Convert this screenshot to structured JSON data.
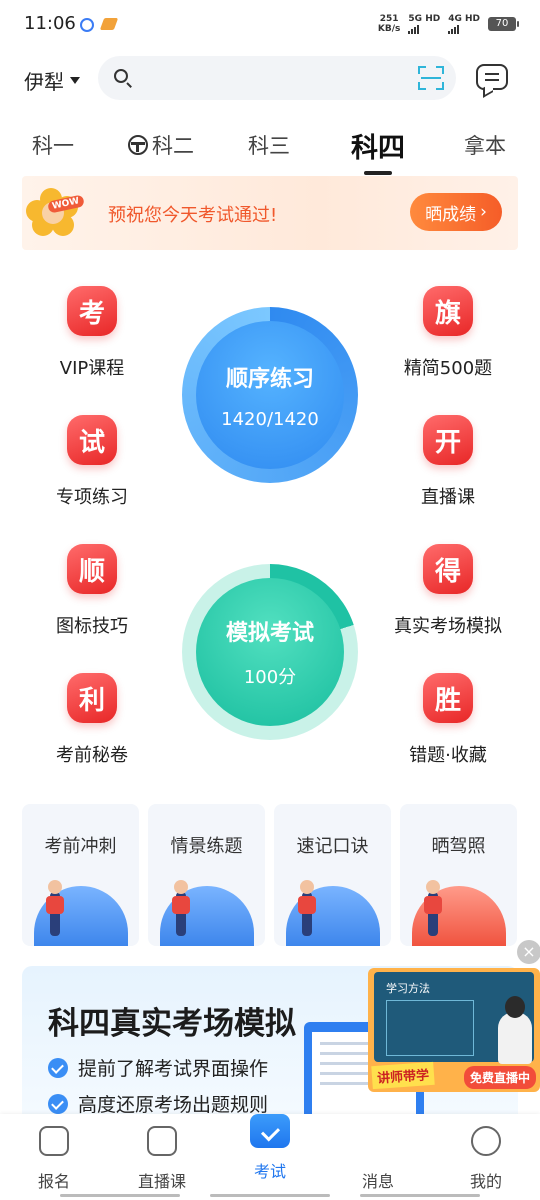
{
  "status_bar": {
    "time": "11:06",
    "speed_value": "251",
    "speed_unit": "KB/s",
    "net1": "5G HD",
    "net2": "4G HD",
    "battery": "70"
  },
  "top_bar": {
    "city": "伊犁",
    "search_placeholder": ""
  },
  "tabs": [
    {
      "label": "科一"
    },
    {
      "label": "科二"
    },
    {
      "label": "科三"
    },
    {
      "label": "科四",
      "active": true
    },
    {
      "label": "拿本"
    }
  ],
  "banner": {
    "badge": "WOW",
    "text": "预祝您今天考试通过!",
    "button": "晒成绩"
  },
  "features_left": [
    {
      "icon": "考",
      "label": "VIP课程"
    },
    {
      "icon": "试",
      "label": "专项练习"
    },
    {
      "icon": "顺",
      "label": "图标技巧"
    },
    {
      "icon": "利",
      "label": "考前秘卷"
    }
  ],
  "features_right": [
    {
      "icon": "旗",
      "label": "精简500题"
    },
    {
      "icon": "开",
      "label": "直播课"
    },
    {
      "icon": "得",
      "label": "真实考场模拟"
    },
    {
      "icon": "胜",
      "label": "错题·收藏"
    }
  ],
  "practice": {
    "title": "顺序练习",
    "progress": "1420/1420",
    "progress_fraction": 1.0
  },
  "exam": {
    "title": "模拟考试",
    "score": "100分",
    "ring_fraction": 0.2
  },
  "cards": [
    {
      "title": "考前冲刺"
    },
    {
      "title": "情景练题"
    },
    {
      "title": "速记口诀"
    },
    {
      "title": "晒驾照"
    }
  ],
  "promo": {
    "title": "科四真实考场模拟",
    "items": [
      "提前了解考试界面操作",
      "高度还原考场出题规则"
    ]
  },
  "ad": {
    "board_title": "学习方法",
    "tag_left": "讲师带学",
    "tag_right": "免费直播中"
  },
  "bottom_nav": [
    {
      "label": "报名",
      "icon": "signup-icon"
    },
    {
      "label": "直播课",
      "icon": "live-icon"
    },
    {
      "label": "考试",
      "icon": "exam-icon",
      "active": true
    },
    {
      "label": "消息",
      "icon": "message-icon"
    },
    {
      "label": "我的",
      "icon": "profile-icon"
    }
  ],
  "colors": {
    "accent_red": "#e82727",
    "practice_blue": "#2f8af0",
    "exam_green": "#1fc2a4",
    "banner_orange": "#f55d28",
    "nav_active": "#1f76ee"
  }
}
